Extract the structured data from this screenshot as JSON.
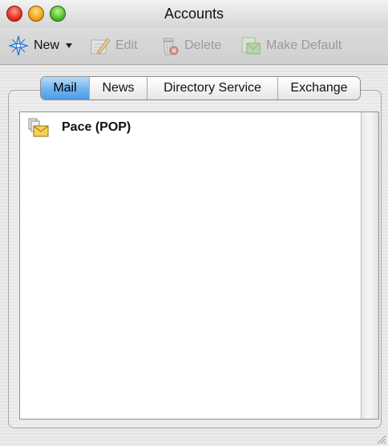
{
  "window": {
    "title": "Accounts"
  },
  "toolbar": {
    "new_label": "New",
    "edit_label": "Edit",
    "delete_label": "Delete",
    "make_default_label": "Make Default"
  },
  "tabs": [
    {
      "label": "Mail",
      "active": true
    },
    {
      "label": "News",
      "active": false
    },
    {
      "label": "Directory Service",
      "active": false
    },
    {
      "label": "Exchange",
      "active": false
    }
  ],
  "accounts": [
    {
      "name": "Pace (POP)",
      "icon": "mail-account-icon"
    }
  ],
  "icons": {
    "new": "new-sparkle-icon",
    "edit": "edit-pencil-icon",
    "delete": "trash-can-icon",
    "make_default": "make-default-icon"
  },
  "colors": {
    "active_tab": "#6eb3ee",
    "disabled_text": "#9a9a9a"
  }
}
